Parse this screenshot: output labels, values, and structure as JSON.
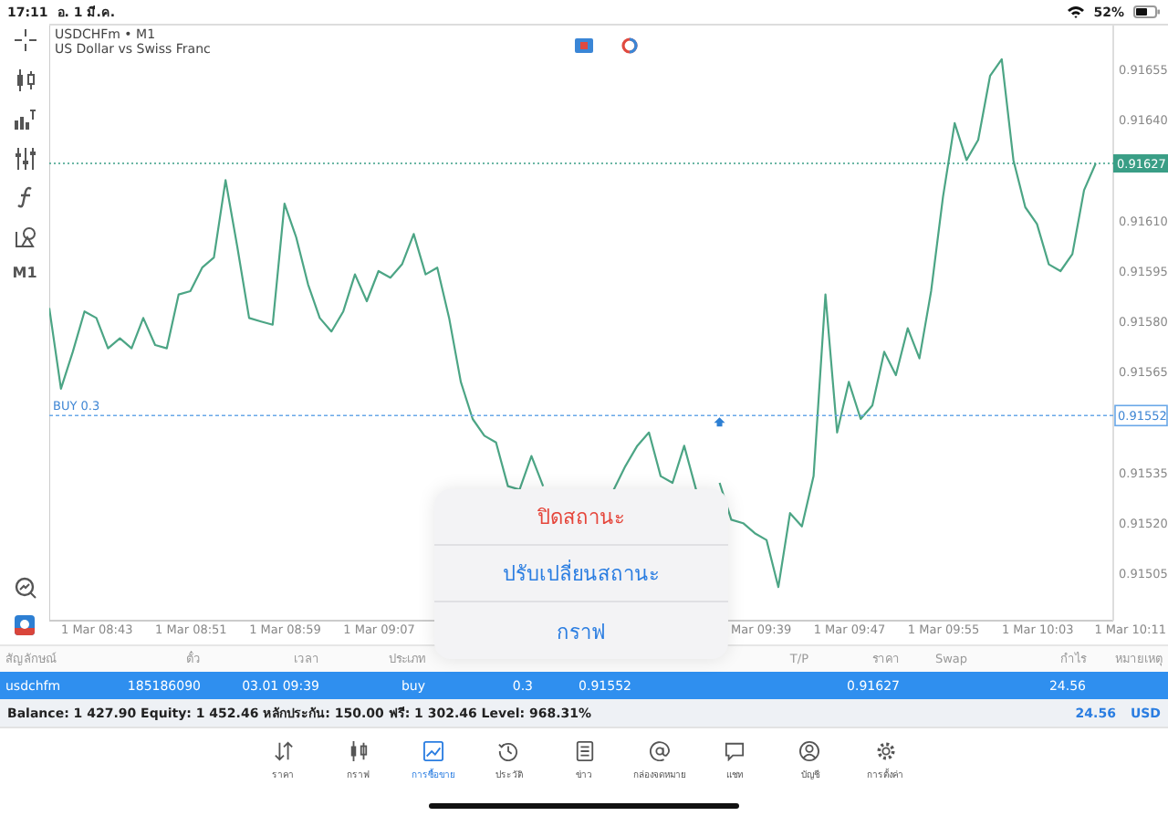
{
  "status_bar": {
    "time": "17:11",
    "date": "อ. 1 มี.ค.",
    "battery": "52%"
  },
  "left_toolbar": {
    "timeframe": "M1"
  },
  "chart": {
    "symbol": "USDCHFm • M1",
    "description": "US Dollar vs Swiss Franc",
    "price_lines": [
      {
        "kind": "bid",
        "price": "0.91627"
      },
      {
        "kind": "order",
        "label": "BUY 0.3",
        "price": "0.91552"
      }
    ],
    "chart_data": {
      "type": "line",
      "ylim": [
        0.91491,
        0.91668
      ],
      "ref_lines": [
        {
          "axis": "y",
          "value": 0.91627,
          "color": "#3a9e86"
        },
        {
          "axis": "y",
          "value": 0.91552,
          "color": "#6aa8e8"
        }
      ],
      "categories": [
        null,
        null,
        null,
        null,
        "1 Mar 08:43",
        null,
        null,
        null,
        null,
        null,
        null,
        null,
        "1 Mar 08:51",
        null,
        null,
        null,
        null,
        null,
        null,
        null,
        "1 Mar 08:59",
        null,
        null,
        null,
        null,
        null,
        null,
        null,
        "1 Mar 09:07",
        null,
        null,
        null,
        null,
        null,
        null,
        null,
        null,
        null,
        null,
        null,
        null,
        null,
        null,
        null,
        null,
        null,
        null,
        null,
        null,
        null,
        null,
        null,
        null,
        null,
        null,
        null,
        null,
        null,
        null,
        null,
        "Mar 09:39",
        null,
        null,
        null,
        null,
        null,
        null,
        null,
        "1 Mar 09:47",
        null,
        null,
        null,
        null,
        null,
        null,
        null,
        "1 Mar 09:55",
        null,
        null,
        null,
        null,
        null,
        null,
        null,
        "1 Mar 10:03",
        null,
        null,
        null,
        null,
        null,
        null,
        null,
        "1 Mar 10:11"
      ],
      "series": [
        {
          "color": "#4ca585",
          "values": [
            0.91584,
            0.9156,
            0.91571,
            0.91583,
            0.91581,
            0.91572,
            0.91575,
            0.91572,
            0.91581,
            0.91573,
            0.91572,
            0.91588,
            0.91589,
            0.91596,
            0.91599,
            0.91622,
            0.91602,
            0.91581,
            0.9158,
            0.91579,
            0.91615,
            0.91605,
            0.91591,
            0.91581,
            0.91577,
            0.91583,
            0.91594,
            0.91586,
            0.91595,
            0.91593,
            0.91597,
            0.91606,
            0.91594,
            0.91596,
            0.91581,
            0.91562,
            0.91551,
            0.91546,
            0.91544,
            0.91531,
            0.9153,
            0.9154,
            0.91531,
            null,
            null,
            null,
            null,
            null,
            0.9153,
            0.91537,
            0.91543,
            0.91547,
            0.91534,
            0.91532,
            0.91543,
            0.9153,
            null,
            0.91532,
            0.91521,
            0.9152,
            0.91517,
            0.91515,
            0.91501,
            0.91523,
            0.91519,
            0.91534,
            0.91588,
            0.91547,
            0.91562,
            0.91551,
            0.91555,
            0.91571,
            0.91564,
            0.91578,
            0.91569,
            0.91589,
            0.91617,
            0.91639,
            0.91628,
            0.91634,
            0.91653,
            0.91658,
            0.91628,
            0.91614,
            0.91609,
            0.91597,
            0.91595,
            0.916,
            0.91619,
            0.91627,
            null,
            null,
            null
          ]
        }
      ],
      "yticks": [
        {
          "value": 0.91655,
          "label": "0.91655"
        },
        {
          "value": 0.9164,
          "label": "0.91640"
        },
        {
          "value": 0.9161,
          "label": "0.91610"
        },
        {
          "value": 0.91595,
          "label": "0.91595"
        },
        {
          "value": 0.9158,
          "label": "0.91580"
        },
        {
          "value": 0.91565,
          "label": "0.91565"
        },
        {
          "value": 0.91535,
          "label": "0.91535"
        },
        {
          "value": 0.9152,
          "label": "0.91520"
        },
        {
          "value": 0.91505,
          "label": "0.91505"
        }
      ]
    }
  },
  "positions_table": {
    "columns": [
      {
        "kind": "text",
        "text": "สัญลักษณ์"
      },
      {
        "kind": "text",
        "text": "ตั๋ว"
      },
      {
        "kind": "text",
        "text": "เวลา"
      },
      {
        "kind": "text",
        "text": "ประเภท"
      },
      {
        "kind": "covered"
      },
      {
        "kind": "covered"
      },
      {
        "kind": "covered"
      },
      {
        "kind": "text",
        "text": "T/P"
      },
      {
        "kind": "text",
        "text": "ราคา"
      },
      {
        "kind": "text",
        "text": "Swap"
      },
      {
        "kind": "text",
        "text": "กำไร"
      },
      {
        "kind": "text",
        "text": "หมายเหตุ"
      }
    ],
    "rows": [
      {
        "selected": true,
        "cells": [
          {
            "kind": "text",
            "text": "usdchfm"
          },
          {
            "kind": "text",
            "text": "185186090"
          },
          {
            "kind": "text",
            "text": "03.01 09:39"
          },
          {
            "kind": "text",
            "text": "buy"
          },
          {
            "kind": "text",
            "text": "0.3"
          },
          {
            "kind": "text",
            "text": "0.91552"
          },
          {
            "kind": "empty"
          },
          {
            "kind": "empty"
          },
          {
            "kind": "text",
            "text": "0.91627"
          },
          {
            "kind": "empty"
          },
          {
            "kind": "text",
            "text": "24.56"
          },
          {
            "kind": "empty"
          }
        ]
      }
    ]
  },
  "account_summary": {
    "text": "Balance: 1 427.90 Equity: 1 452.46 หลักประกัน: 150.00 ฟรี: 1 302.46 Level: 968.31%",
    "total": "24.56",
    "currency": "USD"
  },
  "context_menu": {
    "items": [
      {
        "label": "ปิดสถานะ",
        "kind": "destructive"
      },
      {
        "label": "ปรับเปลี่ยนสถานะ",
        "kind": "default"
      },
      {
        "label": "กราฟ",
        "kind": "default"
      }
    ]
  },
  "tab_bar": [
    {
      "label": "ราคา",
      "selected": false
    },
    {
      "label": "กราฟ",
      "selected": false
    },
    {
      "label": "การซื้อขาย",
      "selected": true
    },
    {
      "label": "ประวัติ",
      "selected": false
    },
    {
      "label": "ข่าว",
      "selected": false
    },
    {
      "label": "กล่องจดหมาย",
      "selected": false
    },
    {
      "label": "แชท",
      "selected": false
    },
    {
      "label": "บัญชี",
      "selected": false
    },
    {
      "label": "การตั้งค่า",
      "selected": false
    }
  ]
}
